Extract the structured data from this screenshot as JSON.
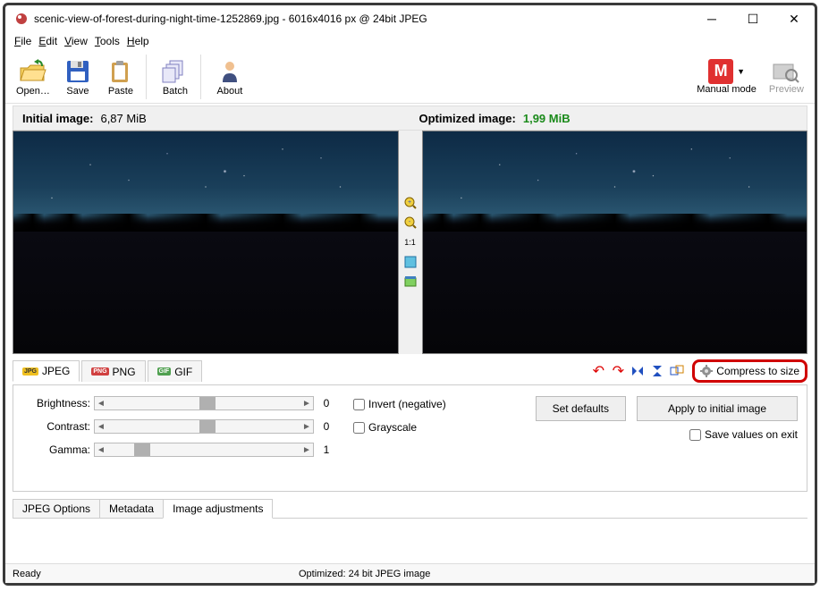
{
  "window": {
    "title": "scenic-view-of-forest-during-night-time-1252869.jpg - 6016x4016 px @ 24bit JPEG"
  },
  "menu": {
    "file": "File",
    "edit": "Edit",
    "view": "View",
    "tools": "Tools",
    "help": "Help"
  },
  "toolbar": {
    "open": "Open…",
    "save": "Save",
    "paste": "Paste",
    "batch": "Batch",
    "about": "About",
    "manual_mode": "Manual mode",
    "preview": "Preview"
  },
  "info": {
    "initial_label": "Initial image:",
    "initial_size": "6,87 MiB",
    "optimized_label": "Optimized image:",
    "optimized_size": "1,99 MiB"
  },
  "midtools": {
    "ratio": "1:1"
  },
  "format_tabs": {
    "jpeg": "JPEG",
    "png": "PNG",
    "gif": "GIF"
  },
  "compress": "Compress to size",
  "adjust": {
    "brightness_label": "Brightness:",
    "brightness_val": "0",
    "contrast_label": "Contrast:",
    "contrast_val": "0",
    "gamma_label": "Gamma:",
    "gamma_val": "1",
    "invert": "Invert (negative)",
    "grayscale": "Grayscale",
    "set_defaults": "Set defaults",
    "apply": "Apply to initial image",
    "save_on_exit": "Save values on exit"
  },
  "bottom_tabs": {
    "jpeg_options": "JPEG Options",
    "metadata": "Metadata",
    "image_adjustments": "Image adjustments"
  },
  "status": {
    "ready": "Ready",
    "optimized": "Optimized: 24 bit JPEG image"
  }
}
